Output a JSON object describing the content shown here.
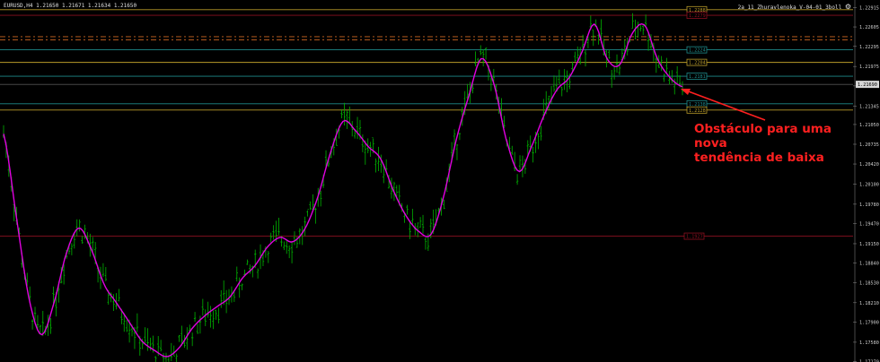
{
  "info_bar": {
    "symbol_quote": "EURUSD,H4 1.21650 1.21671 1.21634 1.21650",
    "indicator": "2a_11_Zhuravlenoka_V-04-01_3boll"
  },
  "annotation": {
    "line1": "Obstáculo para uma nova",
    "line2": "tendência de baixa"
  },
  "colors": {
    "background": "#000000",
    "candle": "#00b400",
    "moving_average": "#e000e0",
    "arrow": "#ff2020",
    "level_gold": "#b89a2a",
    "level_red": "#8a1020",
    "level_teal": "#1e8a8a",
    "level_orange_dashed": "#cc6622",
    "level_gray": "#8a8a8a"
  },
  "chart_data": {
    "type": "line",
    "title": "",
    "xlabel": "",
    "ylabel": "",
    "timeframe": "H4",
    "ylim": [
      1.1735,
      1.2292
    ],
    "y_ticks": [
      "1.22915",
      "1.22605",
      "1.22295",
      "1.21975",
      "1.21665",
      "1.21345",
      "1.21050",
      "1.20735",
      "1.20420",
      "1.20100",
      "1.19780",
      "1.19470",
      "1.19150",
      "1.18840",
      "1.18530",
      "1.18210",
      "1.17900",
      "1.17580",
      "1.17270"
    ],
    "current_price": "1.21690",
    "horizontal_levels": [
      {
        "value": 1.2288,
        "style": "solid",
        "color": "gold",
        "tag": "1.2288"
      },
      {
        "value": 1.2279,
        "style": "solid",
        "color": "red",
        "tag": "1.2279"
      },
      {
        "value": 1.2245,
        "style": "dashed",
        "color": "orange",
        "tag": ""
      },
      {
        "value": 1.224,
        "style": "dashed",
        "color": "orange",
        "tag": ""
      },
      {
        "value": 1.2224,
        "style": "solid",
        "color": "teal",
        "tag": "1.2224"
      },
      {
        "value": 1.2204,
        "style": "solid",
        "color": "gold",
        "tag": "1.2204"
      },
      {
        "value": 1.2182,
        "style": "solid",
        "color": "teal",
        "tag": "1.2181"
      },
      {
        "value": 1.2138,
        "style": "solid",
        "color": "teal",
        "tag": "1.2138"
      },
      {
        "value": 1.2128,
        "style": "solid",
        "color": "gold",
        "tag": "1.2128"
      },
      {
        "value": 1.1927,
        "style": "solid",
        "color": "red",
        "tag": "1.1927"
      }
    ],
    "series": [
      {
        "values": [
          1.209,
          1.196,
          1.183,
          1.177,
          1.182,
          1.19,
          1.194,
          1.1905,
          1.185,
          1.182,
          1.179,
          1.176,
          1.1745,
          1.1735,
          1.175,
          1.178,
          1.18,
          1.1815,
          1.183,
          1.186,
          1.188,
          1.191,
          1.1925,
          1.1918,
          1.194,
          1.199,
          1.206,
          1.211,
          1.2095,
          1.207,
          1.205,
          1.2,
          1.196,
          1.1935,
          1.193,
          1.199,
          1.208,
          1.215,
          1.221,
          1.217,
          1.208,
          1.203,
          1.207,
          1.212,
          1.216,
          1.218,
          1.222,
          1.2265,
          1.221,
          1.22,
          1.225,
          1.2263,
          1.221,
          1.218,
          1.2165
        ]
      }
    ]
  }
}
